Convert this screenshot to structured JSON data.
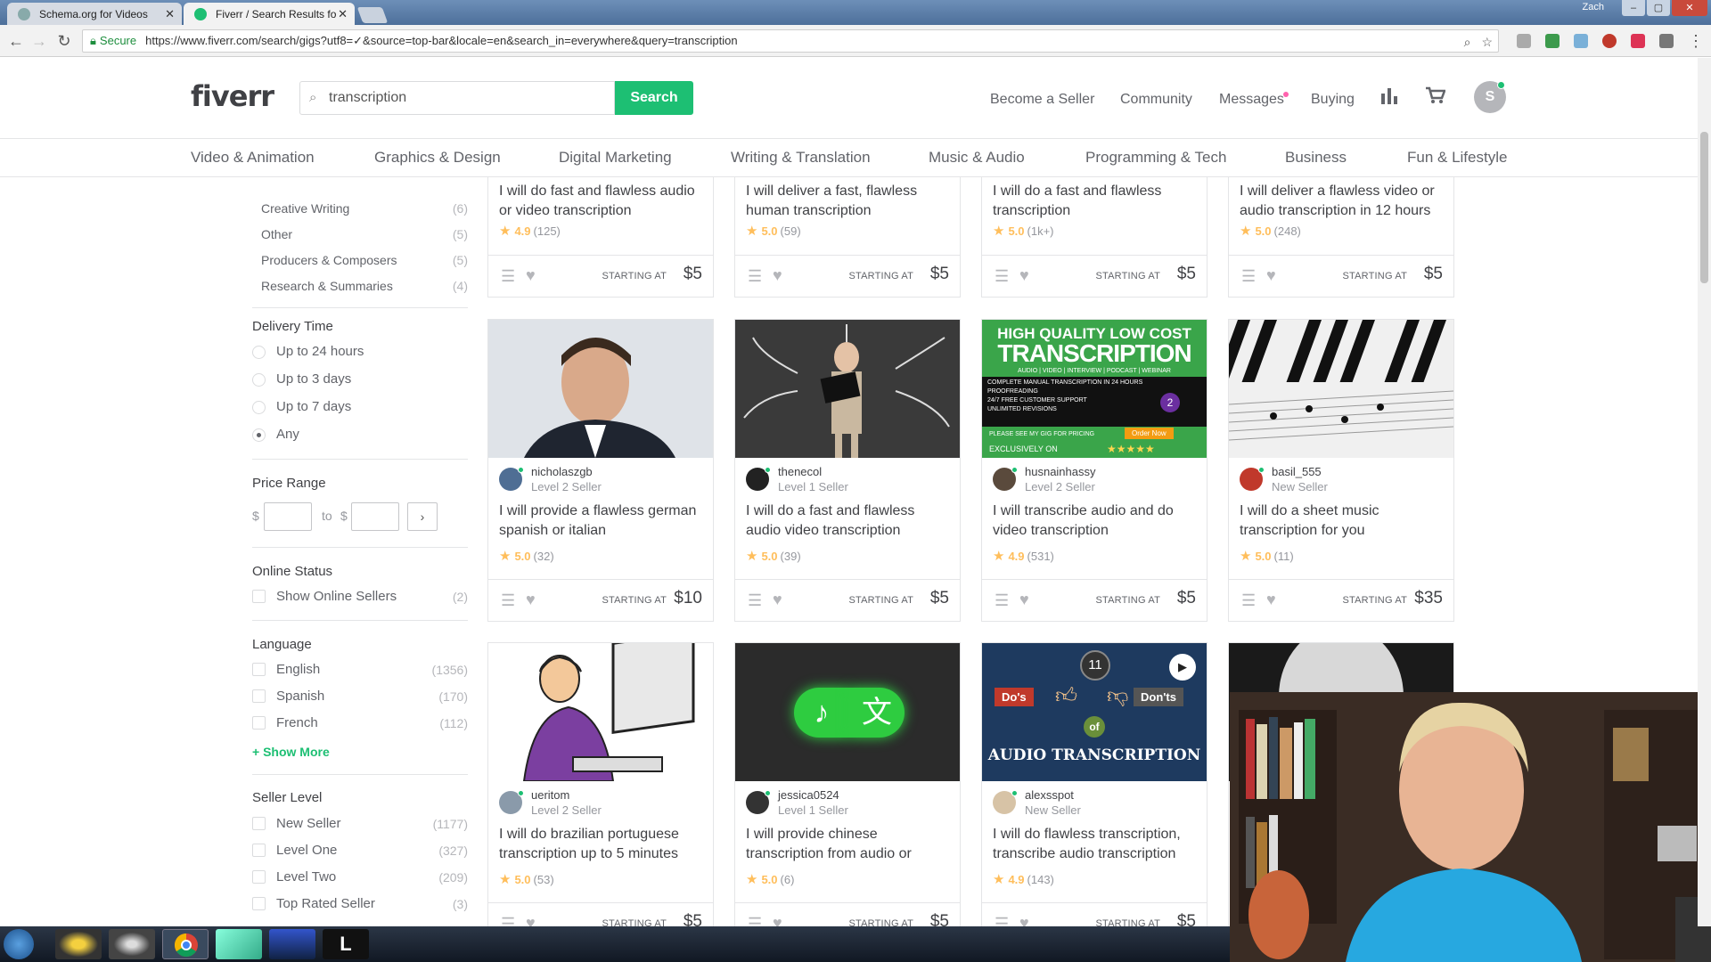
{
  "browser": {
    "tabs": [
      {
        "title": "Schema.org for Videos",
        "active": false
      },
      {
        "title": "Fiverr / Search Results fo",
        "active": true
      }
    ],
    "secure_label": "Secure",
    "url": "https://www.fiverr.com/search/gigs?utf8=✓&source=top-bar&locale=en&search_in=everywhere&query=transcription",
    "window_user": "Zach"
  },
  "header": {
    "logo": "fiverr",
    "search_value": "transcription",
    "search_button": "Search",
    "nav": [
      "Become a Seller",
      "Community",
      "Messages",
      "Buying"
    ],
    "avatar_initial": "S"
  },
  "categories": [
    "Video & Animation",
    "Graphics & Design",
    "Digital Marketing",
    "Writing & Translation",
    "Music & Audio",
    "Programming & Tech",
    "Business",
    "Fun & Lifestyle"
  ],
  "sidebar": {
    "subcategories": [
      {
        "label": "Creative Writing",
        "count": "(6)"
      },
      {
        "label": "Other",
        "count": "(5)"
      },
      {
        "label": "Producers & Composers",
        "count": "(5)"
      },
      {
        "label": "Research & Summaries",
        "count": "(4)"
      }
    ],
    "delivery": {
      "heading": "Delivery Time",
      "options": [
        "Up to 24 hours",
        "Up to 3 days",
        "Up to 7 days",
        "Any"
      ],
      "selected": "Any"
    },
    "price": {
      "heading": "Price Range",
      "currency": "$",
      "to": "to",
      "go": "›"
    },
    "online": {
      "heading": "Online Status",
      "label": "Show Online Sellers",
      "count": "(2)"
    },
    "language": {
      "heading": "Language",
      "options": [
        {
          "label": "English",
          "count": "(1356)"
        },
        {
          "label": "Spanish",
          "count": "(170)"
        },
        {
          "label": "French",
          "count": "(112)"
        }
      ],
      "show_more": "+ Show More"
    },
    "seller_level": {
      "heading": "Seller Level",
      "options": [
        {
          "label": "New Seller",
          "count": "(1177)"
        },
        {
          "label": "Level One",
          "count": "(327)"
        },
        {
          "label": "Level Two",
          "count": "(209)"
        },
        {
          "label": "Top Rated Seller",
          "count": "(3)"
        }
      ]
    }
  },
  "gigs_row1": [
    {
      "title": "I will do fast and flawless audio or video transcription",
      "rating": "4.9",
      "reviews": "(125)",
      "price": "$5"
    },
    {
      "title": "I will deliver a fast, flawless human transcription",
      "rating": "5.0",
      "reviews": "(59)",
      "price": "$5"
    },
    {
      "title": "I will do a fast and flawless transcription",
      "rating": "5.0",
      "reviews": "(1k+)",
      "price": "$5"
    },
    {
      "title": "I will deliver a flawless video or audio transcription in 12 hours",
      "rating": "5.0",
      "reviews": "(248)",
      "price": "$5"
    }
  ],
  "gigs_row2": [
    {
      "seller": "nicholaszgb",
      "level": "Level 2 Seller",
      "title": "I will provide a flawless german spanish or italian",
      "rating": "5.0",
      "reviews": "(32)",
      "price": "$10"
    },
    {
      "seller": "thenecol",
      "level": "Level 1 Seller",
      "title": "I will do a fast and flawless audio video transcription",
      "rating": "5.0",
      "reviews": "(39)",
      "price": "$5"
    },
    {
      "seller": "husnainhassy",
      "level": "Level 2 Seller",
      "title": "I will transcribe audio and do video transcription",
      "rating": "4.9",
      "reviews": "(531)",
      "price": "$5"
    },
    {
      "seller": "basil_555",
      "level": "New Seller",
      "title": "I will do a sheet music transcription for you",
      "rating": "5.0",
      "reviews": "(11)",
      "price": "$35"
    }
  ],
  "gigs_row3": [
    {
      "seller": "ueritom",
      "level": "Level 2 Seller",
      "title": "I will do brazilian portuguese transcription up to 5 minutes",
      "rating": "5.0",
      "reviews": "(53)",
      "price": "$5"
    },
    {
      "seller": "jessica0524",
      "level": "Level 1 Seller",
      "title": "I will provide chinese transcription from audio or",
      "rating": "5.0",
      "reviews": "(6)",
      "price": "$5"
    },
    {
      "seller": "alexsspot",
      "level": "New Seller",
      "title": "I will do flawless transcription, transcribe audio transcription",
      "rating": "4.9",
      "reviews": "(143)",
      "price": "$5"
    }
  ],
  "card_footer": {
    "starting_at": "STARTING AT"
  },
  "thumb_text": {
    "tx_heading": "HIGH QUALITY LOW COST",
    "tx_big": "TRANSCRIPTION",
    "tx_sub": "AUDIO | VIDEO | INTERVIEW | PODCAST | WEBINAR",
    "tx_lines": [
      "COMPLETE MANUAL TRANSCRIPTION IN 24 HOURS",
      "PROOFREADING",
      "24/7 FREE CUSTOMER SUPPORT",
      "UNLIMITED REVISIONS"
    ],
    "tx_pricing": "PLEASE SEE MY GIG FOR PRICING",
    "tx_order": "Order Now",
    "tx_exclusive": "EXCLUSIVELY ON",
    "chinese_glyph": "文",
    "note_glyph": "♪",
    "dos": "Do's",
    "donts": "Don'ts",
    "of": "of",
    "audio_tx": "AUDIO TRANSCRIPTION",
    "badge": "11"
  },
  "colors": {
    "brand": "#1dbf73",
    "star": "#ffbe5b",
    "text": "#404145",
    "muted": "#95979d"
  }
}
